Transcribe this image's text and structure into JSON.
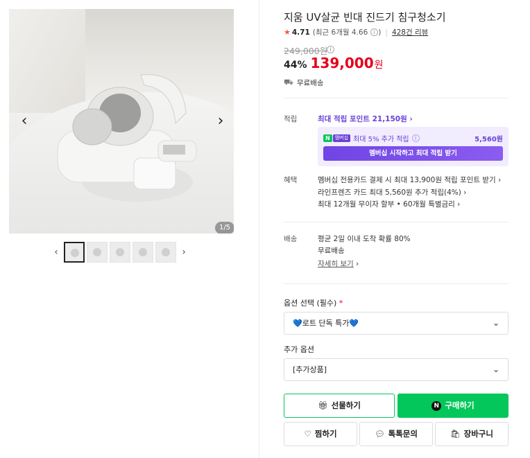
{
  "gallery": {
    "prev_icon": "chevron-left-icon",
    "next_icon": "chevron-right-icon",
    "counter": "1/5",
    "thumb_count": 5
  },
  "product": {
    "title": "지움 UV살균 빈대 진드기 침구청소기",
    "rating": "4.71",
    "rating_recent": "(최근 6개월 4.66",
    "reviews": "428건 리뷰",
    "original_price": "249,000원",
    "discount": "44%",
    "price": "139,000",
    "currency": "원",
    "shipping": "무료배송"
  },
  "points": {
    "label": "적립",
    "max_points": "최대 적립 포인트 21,150원",
    "member_badge_n": "N",
    "member_badge": "멤버십",
    "member_extra": "최대 5% 추가 적립",
    "member_amount": "5,560원",
    "member_button": "멤버십 시작하고 최대 적립 받기"
  },
  "benefits": {
    "label": "혜택",
    "items": [
      "멤버십 전용카드 결제 시 최대 13,900원 적립 포인트 받기",
      "라인프렌즈 카드 최대 5,560원 추가 적립(4%)",
      "최대 12개월 무이자 할부 • 60개월 특별금리"
    ]
  },
  "delivery": {
    "label": "배송",
    "line1": "평균 2일 이내 도착 확률 80%",
    "line2": "무료배송",
    "more": "자세히 보기"
  },
  "options": {
    "required_label": "옵션 선택 (필수)",
    "required_mark": "*",
    "required_value": "💙로트 단독 특가💙",
    "extra_label": "추가 옵션",
    "extra_value": "[추가상품]"
  },
  "actions": {
    "gift": "선물하기",
    "buy": "구매하기",
    "wish": "찜하기",
    "talk": "톡톡문의",
    "cart": "장바구니"
  },
  "colors": {
    "accent_green": "#03c75a",
    "price_red": "#e5001c",
    "membership_purple": "#6a3fd8"
  }
}
